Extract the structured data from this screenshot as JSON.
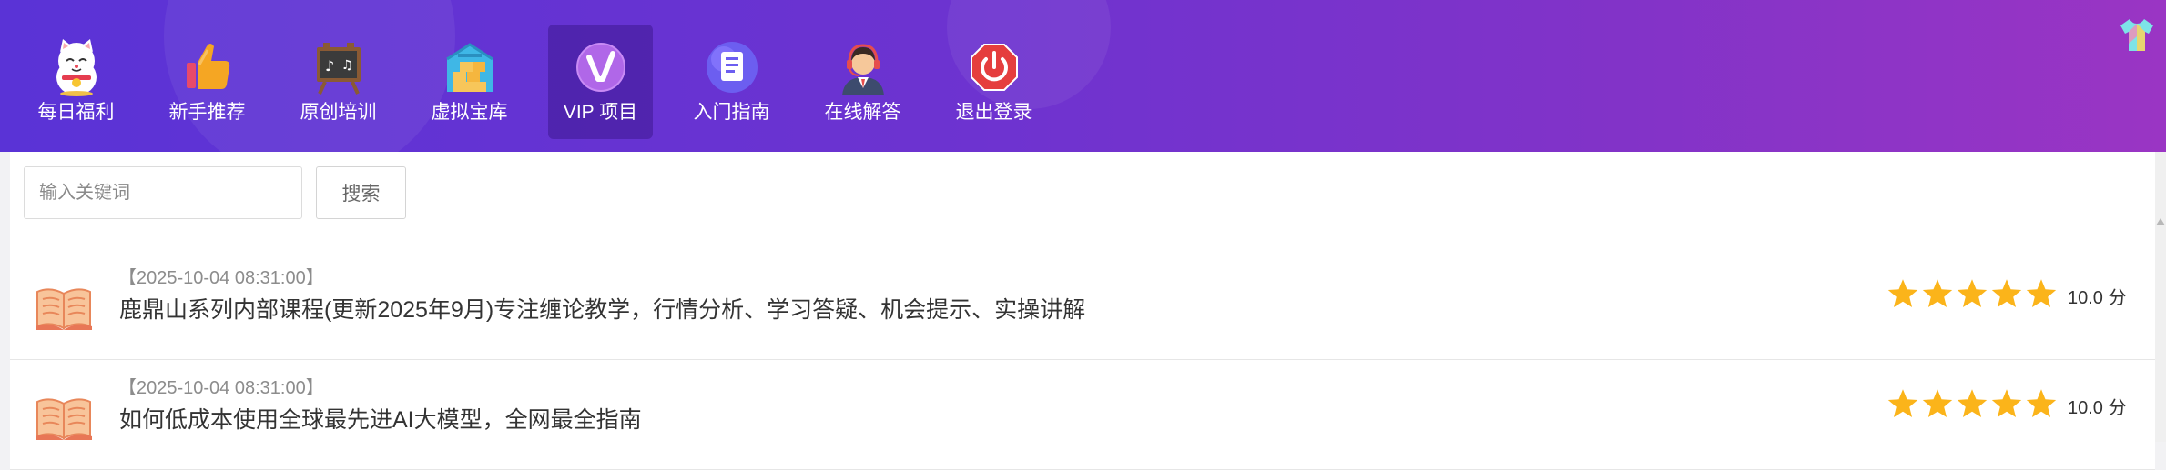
{
  "nav": {
    "items": [
      {
        "label": "每日福利",
        "icon": "lucky-cat-icon"
      },
      {
        "label": "新手推荐",
        "icon": "thumbs-up-icon"
      },
      {
        "label": "原创培训",
        "icon": "chalkboard-icon"
      },
      {
        "label": "虚拟宝库",
        "icon": "warehouse-icon"
      },
      {
        "label": "VIP 项目",
        "icon": "vip-icon",
        "active": true
      },
      {
        "label": "入门指南",
        "icon": "document-icon"
      },
      {
        "label": "在线解答",
        "icon": "customer-service-icon"
      },
      {
        "label": "退出登录",
        "icon": "power-icon"
      }
    ]
  },
  "search": {
    "placeholder": "输入关键词",
    "button_label": "搜索"
  },
  "list": [
    {
      "date": "【2025-10-04 08:31:00】",
      "title": "鹿鼎山系列内部课程(更新2025年9月)专注缠论教学，行情分析、学习答疑、机会提示、实操讲解",
      "stars": 5,
      "score": "10.0 分"
    },
    {
      "date": "【2025-10-04 08:31:00】",
      "title": "如何低成本使用全球最先进AI大模型，全网最全指南",
      "stars": 5,
      "score": "10.0 分"
    }
  ],
  "colors": {
    "header_gradient_start": "#5a33d6",
    "header_gradient_end": "#9a35c4",
    "star": "#fbb41a",
    "book": "#f4a06c"
  }
}
